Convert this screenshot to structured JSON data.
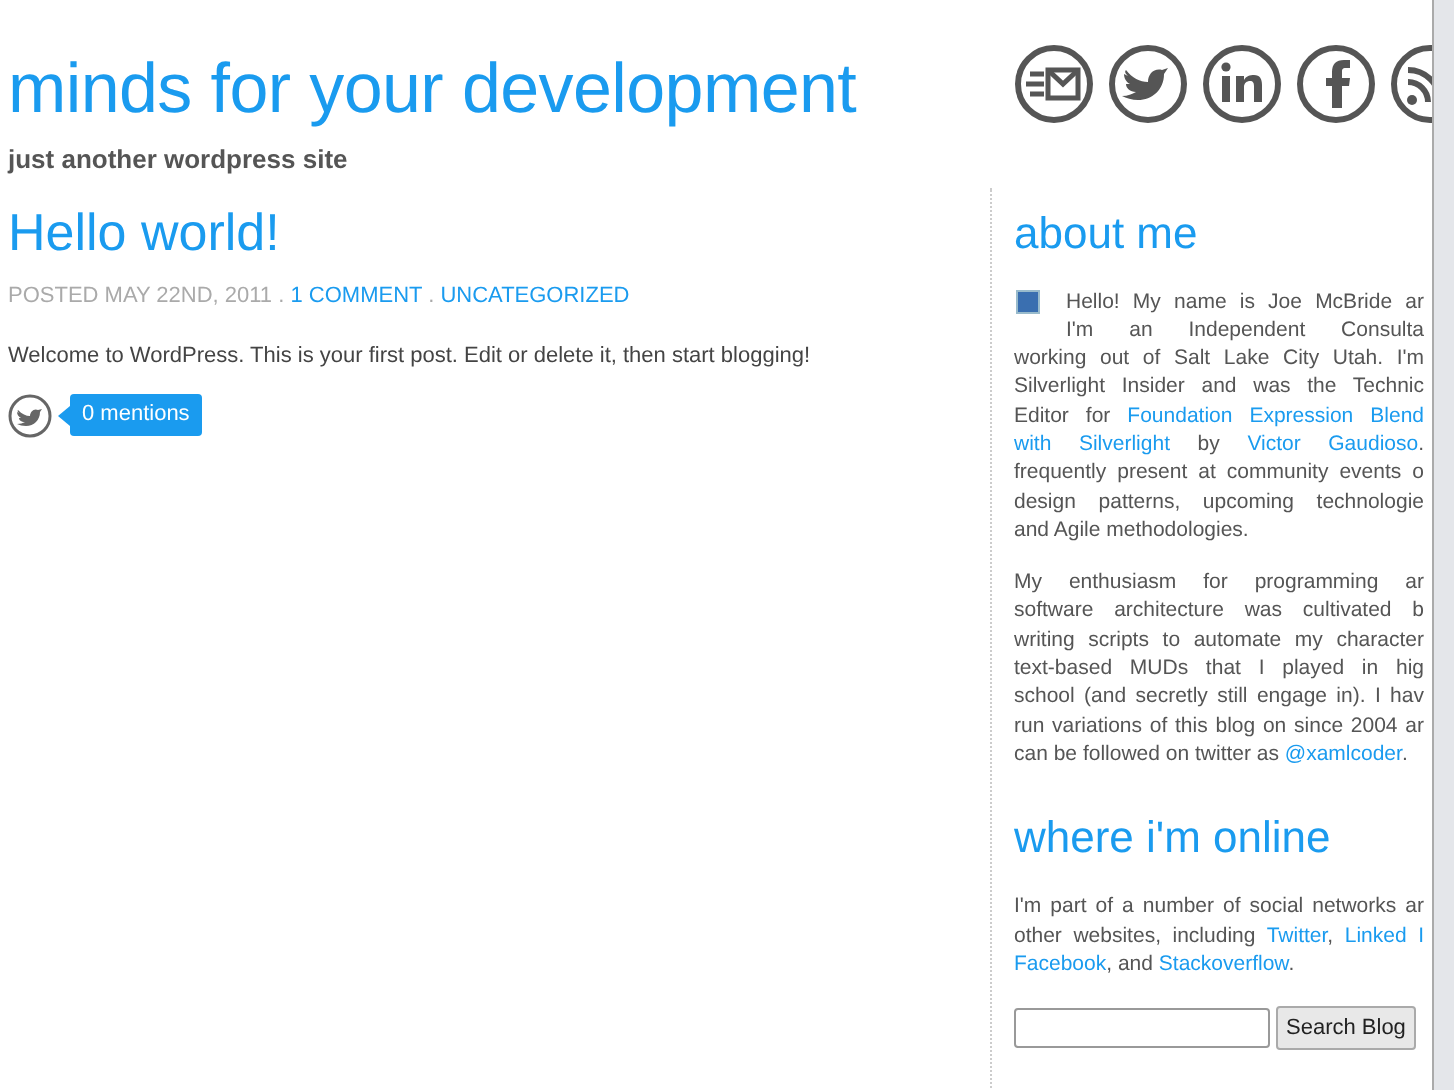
{
  "site": {
    "title": "minds for your development",
    "tagline": "just another wordpress site"
  },
  "post": {
    "title": "Hello world!",
    "meta": [
      {
        "text": "POSTED MAY 22ND, 2011 . ",
        "link": false
      },
      {
        "text": "1 COMMENT",
        "link": true
      },
      {
        "text": " . ",
        "link": false
      },
      {
        "text": "UNCATEGORIZED",
        "link": true
      }
    ],
    "body": "Welcome to WordPress. This is your first post. Edit or delete it, then start blogging!",
    "mentions": "0 mentions"
  },
  "sidebar": {
    "sections": [
      {
        "heading": "about me",
        "paragraphs": [
          {
            "avatar": true,
            "lines": [
              [
                {
                  "text": "Hello! My name is Joe McBride ar",
                  "link": false
                }
              ],
              [
                {
                  "text": "I'm an Independent Consulta",
                  "link": false
                }
              ],
              [
                {
                  "text": "working out of Salt Lake City Utah. I'm",
                  "link": false
                }
              ],
              [
                {
                  "text": "Silverlight Insider and was the Technic",
                  "link": false
                }
              ],
              [
                {
                  "text": "Editor for ",
                  "link": false
                },
                {
                  "text": "Foundation Expression Blend",
                  "link": true
                }
              ],
              [
                {
                  "text": "with Silverlight",
                  "link": true
                },
                {
                  "text": " by ",
                  "link": false
                },
                {
                  "text": "Victor Gaudioso",
                  "link": true
                },
                {
                  "text": ".",
                  "link": false
                }
              ],
              [
                {
                  "text": "frequently present at community events o",
                  "link": false
                }
              ],
              [
                {
                  "text": "design patterns, upcoming technologie",
                  "link": false
                }
              ],
              [
                {
                  "text": "and Agile methodologies.",
                  "link": false
                }
              ]
            ]
          },
          {
            "avatar": false,
            "lines": [
              [
                {
                  "text": "My enthusiasm for programming ar",
                  "link": false
                }
              ],
              [
                {
                  "text": "software architecture was cultivated b",
                  "link": false
                }
              ],
              [
                {
                  "text": "writing scripts to automate my character",
                  "link": false
                }
              ],
              [
                {
                  "text": "text-based MUDs that I played in hig",
                  "link": false
                }
              ],
              [
                {
                  "text": "school (and secretly still engage in). I hav",
                  "link": false
                }
              ],
              [
                {
                  "text": "run variations of this blog on since 2004 ar",
                  "link": false
                }
              ],
              [
                {
                  "text": "can be followed on twitter as ",
                  "link": false
                },
                {
                  "text": "@xamlcoder",
                  "link": true
                },
                {
                  "text": ".",
                  "link": false
                }
              ]
            ]
          }
        ]
      },
      {
        "heading": "where i'm online",
        "paragraphs": [
          {
            "avatar": false,
            "lines": [
              [
                {
                  "text": "I'm part of a number of social networks ar",
                  "link": false
                }
              ],
              [
                {
                  "text": "other websites, including ",
                  "link": false
                },
                {
                  "text": "Twitter",
                  "link": true
                },
                {
                  "text": ", ",
                  "link": false
                },
                {
                  "text": "Linked I",
                  "link": true
                }
              ],
              [
                {
                  "text": "Facebook",
                  "link": true
                },
                {
                  "text": ", and ",
                  "link": false
                },
                {
                  "text": "Stackoverflow",
                  "link": true
                },
                {
                  "text": ".",
                  "link": false
                }
              ]
            ]
          }
        ]
      }
    ]
  },
  "search": {
    "button": "Search Blog"
  }
}
